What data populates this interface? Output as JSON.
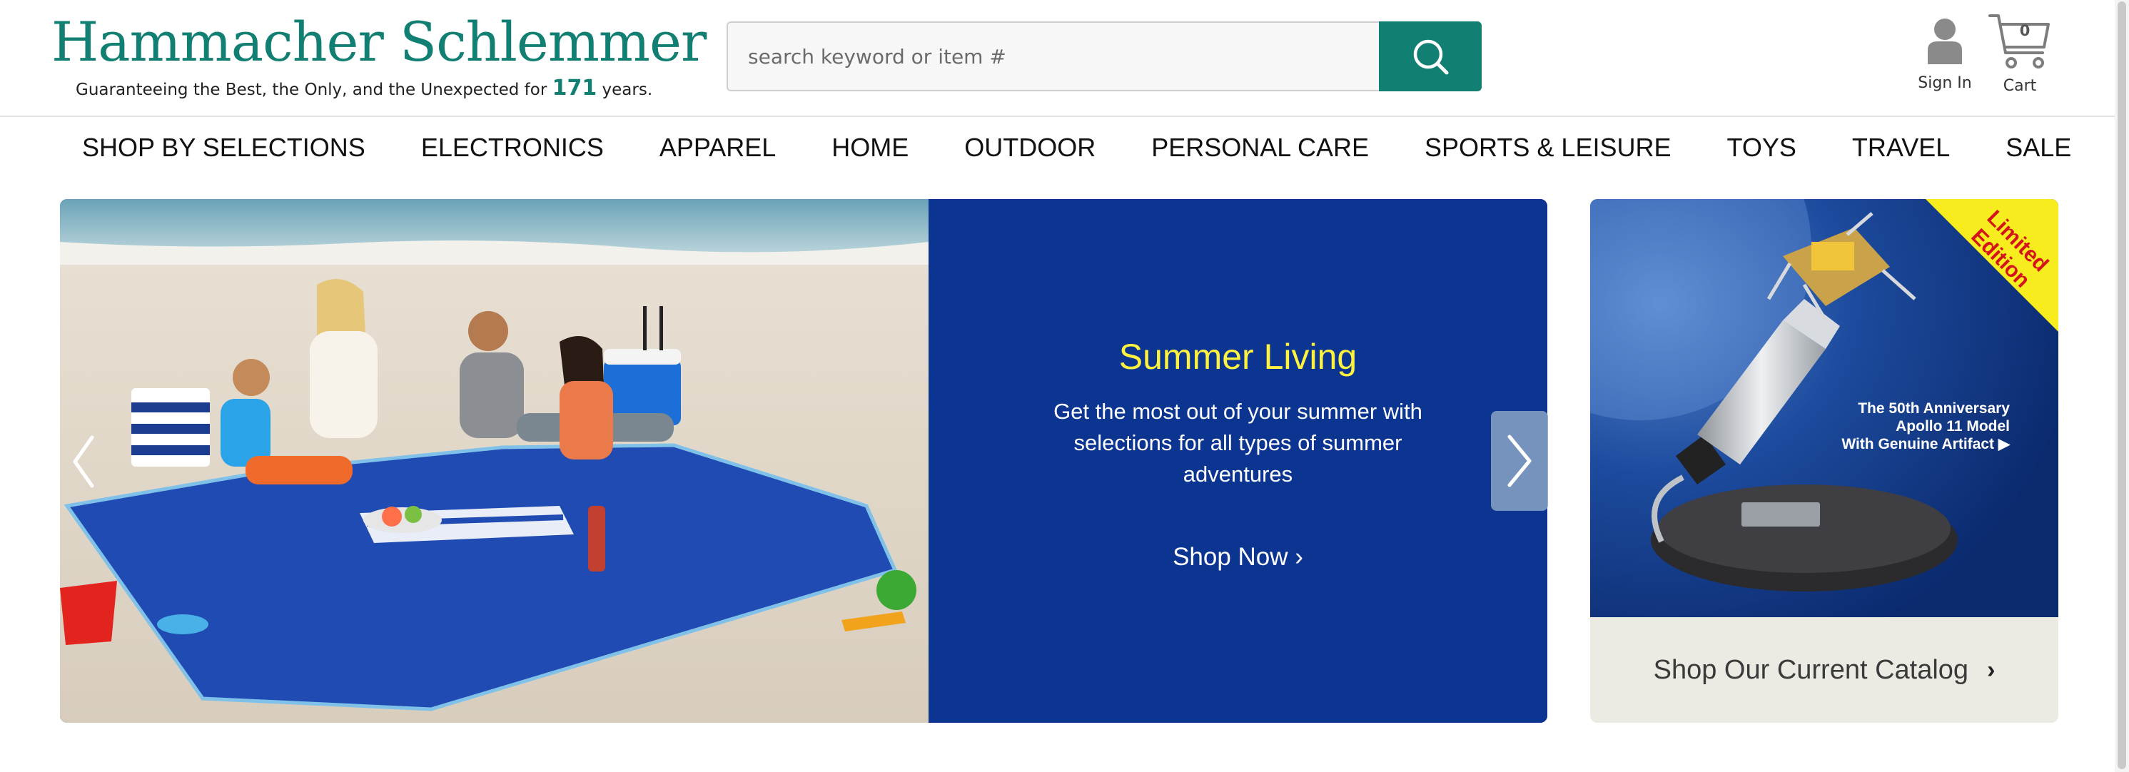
{
  "brand": {
    "name": "Hammacher Schlemmer",
    "tagline_prefix": "Guaranteeing the Best, the Only, and the Unexpected for",
    "tagline_years": "171",
    "tagline_suffix": "years."
  },
  "search": {
    "placeholder": "search keyword or item #",
    "button_icon": "search-icon"
  },
  "account": {
    "label": "Sign In",
    "icon": "user-icon"
  },
  "cart": {
    "label": "Cart",
    "count": "0",
    "icon": "cart-icon"
  },
  "nav": {
    "items": [
      "SHOP BY SELECTIONS",
      "ELECTRONICS",
      "APPAREL",
      "HOME",
      "OUTDOOR",
      "PERSONAL CARE",
      "SPORTS & LEISURE",
      "TOYS",
      "TRAVEL",
      "SALE"
    ]
  },
  "hero": {
    "title": "Summer Living",
    "text": "Get the most out of your summer with selections for all types of summer adventures",
    "cta": "Shop Now ›",
    "prev_icon": "chevron-left-icon",
    "next_icon": "chevron-right-icon",
    "colors": {
      "panel": "#0b3590",
      "title": "#fff23e"
    }
  },
  "promo": {
    "badge_line1": "Limited",
    "badge_line2": "Edition",
    "caption_line1": "The 50th Anniversary",
    "caption_line2": "Apollo 11 Model",
    "caption_line3": "With Genuine Artifact ▶",
    "catalog_link": "Shop Our Current Catalog",
    "catalog_chevron": "›"
  },
  "colors": {
    "brand": "#127f73",
    "badge": "#f7ec1d",
    "badge_text": "#d4141b"
  }
}
